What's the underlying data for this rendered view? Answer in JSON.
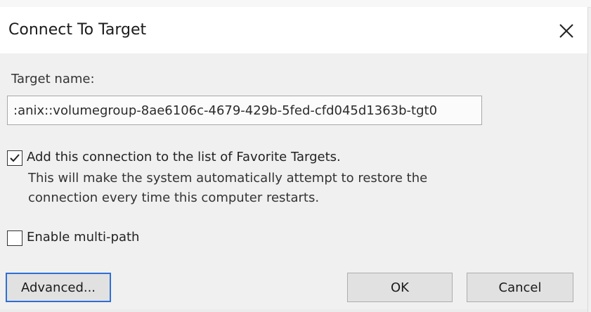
{
  "dialog": {
    "title": "Connect To Target",
    "close_icon": "close-icon"
  },
  "target": {
    "label": "Target name:",
    "value": ":anix::volumegroup-8ae6106c-4679-429b-5fed-cfd045d1363b-tgt0"
  },
  "favorite": {
    "label": "Add this connection to the list of Favorite Targets.",
    "description": "This will make the system automatically attempt to restore the connection every time this computer restarts.",
    "checked": true
  },
  "multipath": {
    "label": "Enable multi-path",
    "checked": false
  },
  "buttons": {
    "advanced": "Advanced...",
    "ok": "OK",
    "cancel": "Cancel"
  },
  "colors": {
    "focus_border": "#2f6fd6",
    "dialog_bg": "#f0f0f0",
    "button_bg": "#e1e1e1"
  }
}
